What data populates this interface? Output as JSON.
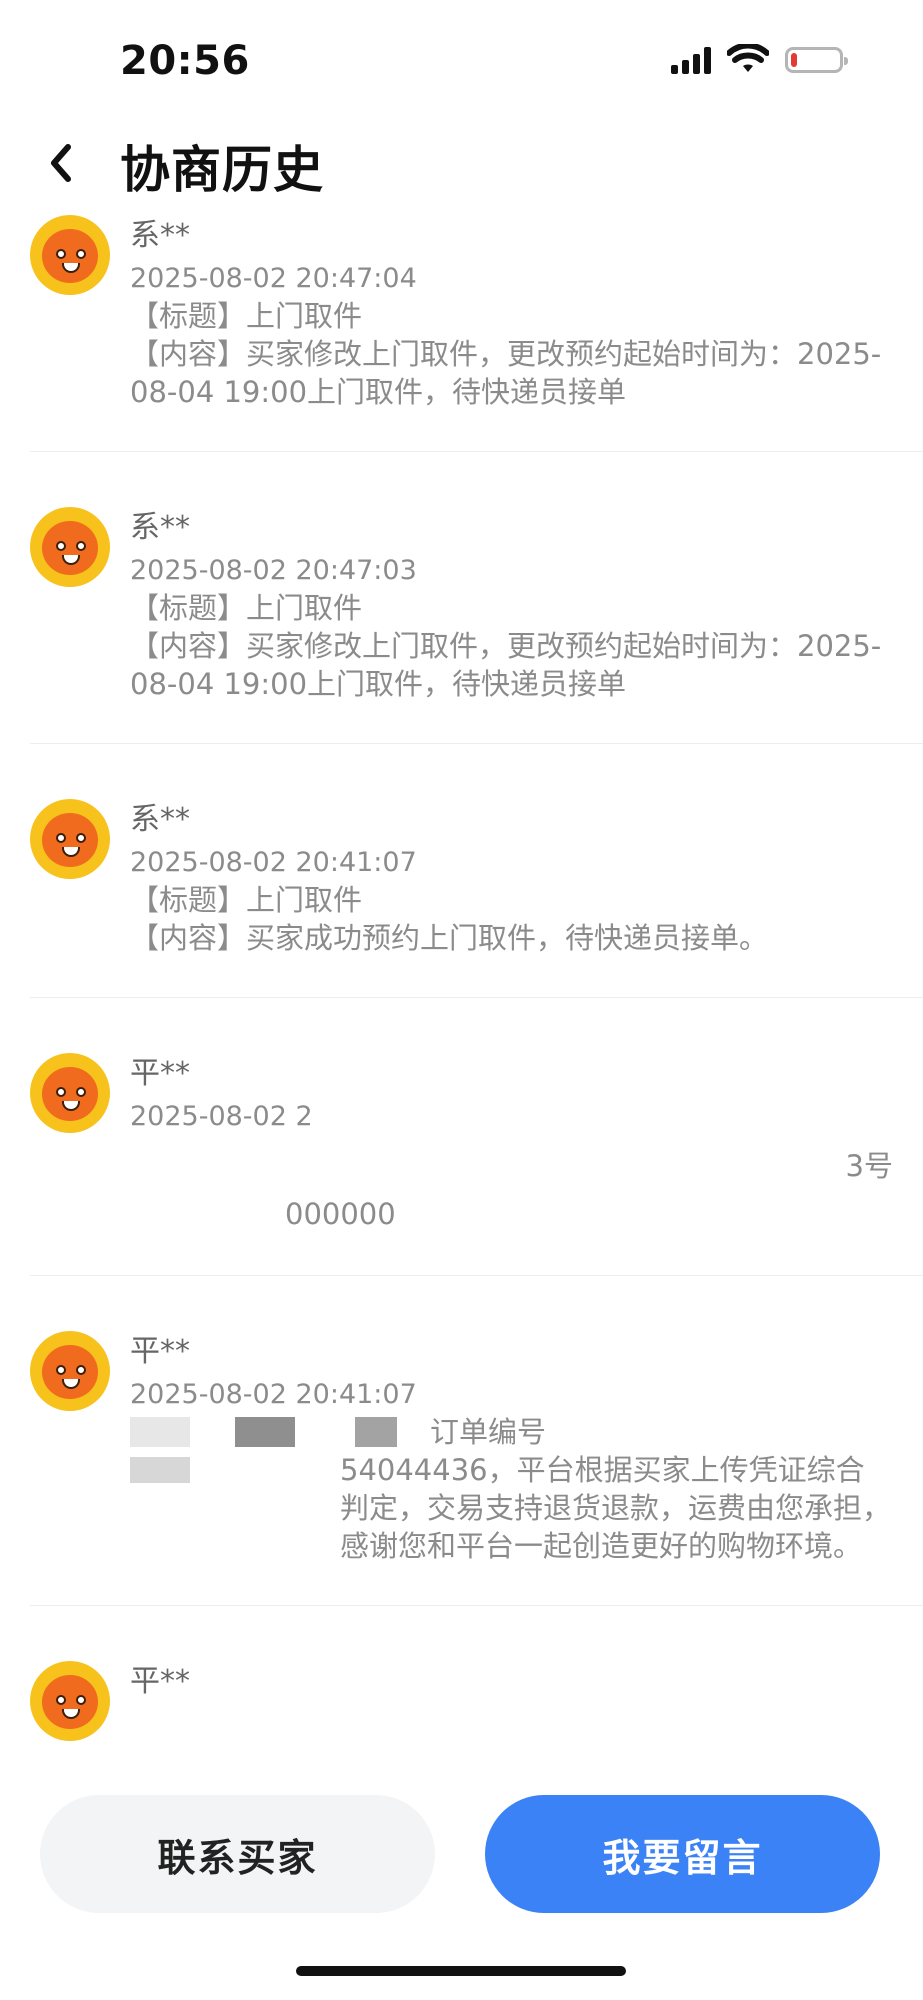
{
  "status_bar": {
    "time": "20:56"
  },
  "header": {
    "title": "协商历史"
  },
  "history": [
    {
      "name": "系**",
      "time": "2025-08-02 20:47:04",
      "lines": [
        "【标题】上门取件",
        "【内容】买家修改上门取件，更改预约起始时间为：2025-08-04 19:00上门取件，待快递员接单"
      ]
    },
    {
      "name": "系**",
      "time": "2025-08-02 20:47:03",
      "lines": [
        "【标题】上门取件",
        "【内容】买家修改上门取件，更改预约起始时间为：2025-08-04 19:00上门取件，待快递员接单"
      ]
    },
    {
      "name": "系**",
      "time": "2025-08-02 20:41:07",
      "lines": [
        "【标题】上门取件",
        "【内容】买家成功预约上门取件，待快递员接单。"
      ]
    },
    {
      "name": "平**",
      "time": "2025-08-02 2",
      "lines": [
        "3号",
        "000000"
      ]
    },
    {
      "name": "平**",
      "time": "2025-08-02 20:41:07",
      "lines": [
        "订单编号",
        "54044436，平台根据买家上传凭证综合判定，交易支持退货退款，运费由您承担，感谢您和平台一起创造更好的购物环境。"
      ]
    },
    {
      "name": "平**",
      "time": "",
      "lines": []
    }
  ],
  "actions": {
    "contact_buyer": "联系买家",
    "leave_message": "我要留言"
  }
}
